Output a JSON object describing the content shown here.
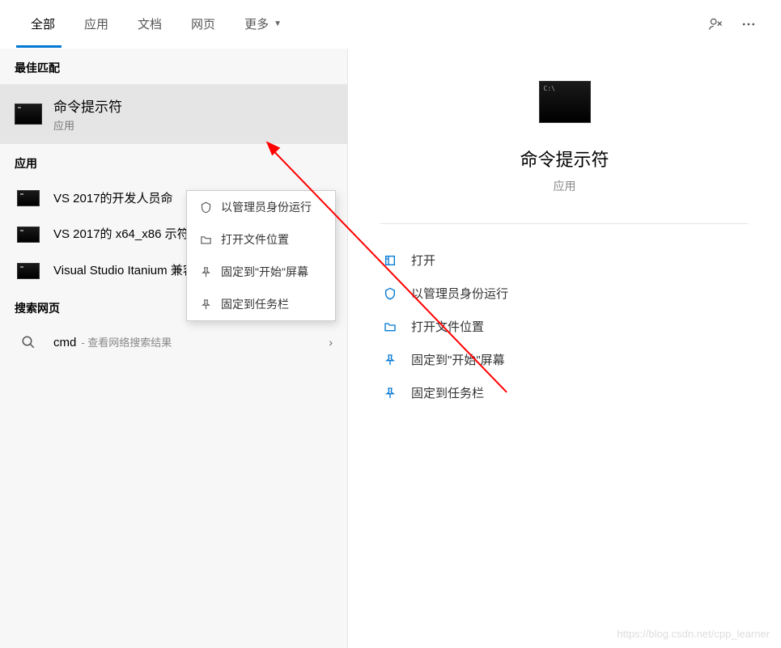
{
  "tabs": {
    "all": "全部",
    "apps": "应用",
    "docs": "文档",
    "web": "网页",
    "more": "更多"
  },
  "sections": {
    "best_match": "最佳匹配",
    "apps": "应用",
    "search_web": "搜索网页"
  },
  "best_match": {
    "title": "命令提示符",
    "subtitle": "应用"
  },
  "app_results": [
    {
      "title": "VS 2017的开发人员命"
    },
    {
      "title": "VS 2017的 x64_x86 示符"
    },
    {
      "title": "Visual Studio Itanium 兼容工具命令提示(2010)"
    }
  ],
  "web_result": {
    "query": "cmd",
    "desc": "- 查看网络搜索结果"
  },
  "context_menu": [
    {
      "icon": "shield",
      "label": "以管理员身份运行"
    },
    {
      "icon": "folder",
      "label": "打开文件位置"
    },
    {
      "icon": "pin",
      "label": "固定到\"开始\"屏幕"
    },
    {
      "icon": "pin",
      "label": "固定到任务栏"
    }
  ],
  "detail": {
    "title": "命令提示符",
    "subtitle": "应用",
    "actions": [
      {
        "icon": "open",
        "label": "打开"
      },
      {
        "icon": "shield",
        "label": "以管理员身份运行"
      },
      {
        "icon": "folder",
        "label": "打开文件位置"
      },
      {
        "icon": "pin",
        "label": "固定到\"开始\"屏幕"
      },
      {
        "icon": "pin",
        "label": "固定到任务栏"
      }
    ]
  },
  "watermark": "https://blog.csdn.net/cpp_learner"
}
